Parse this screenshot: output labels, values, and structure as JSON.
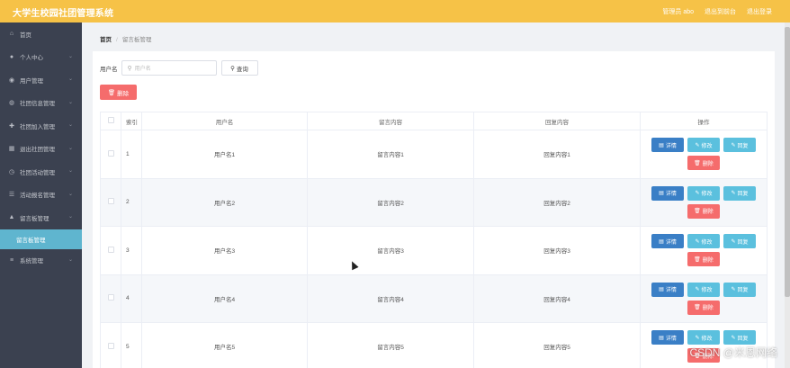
{
  "header": {
    "title": "大学生校园社团管理系统",
    "user_text": "管理员 abo",
    "link_back": "退出到前台",
    "link_logout": "退出登录"
  },
  "sidebar": {
    "items": [
      {
        "label": "首页",
        "icon": "home-icon",
        "glyph": "⌂",
        "expandable": false
      },
      {
        "label": "个人中心",
        "icon": "user-icon",
        "glyph": "●",
        "expandable": true
      },
      {
        "label": "用户管理",
        "icon": "location-icon",
        "glyph": "◉",
        "expandable": true
      },
      {
        "label": "社团信息管理",
        "icon": "info-icon",
        "glyph": "◍",
        "expandable": true
      },
      {
        "label": "社团加入管理",
        "icon": "user-add-icon",
        "glyph": "✚",
        "expandable": true
      },
      {
        "label": "退出社团管理",
        "icon": "grid-icon",
        "glyph": "▦",
        "expandable": true
      },
      {
        "label": "社团活动管理",
        "icon": "clock-icon",
        "glyph": "◷",
        "expandable": true
      },
      {
        "label": "活动报名管理",
        "icon": "list-icon",
        "glyph": "☰",
        "expandable": true
      },
      {
        "label": "留言板管理",
        "icon": "person-icon",
        "glyph": "▲",
        "expandable": true
      },
      {
        "label": "留言板管理",
        "icon": "",
        "glyph": "",
        "expandable": false,
        "sub": true,
        "active": true
      },
      {
        "label": "系统管理",
        "icon": "menu-icon",
        "glyph": "≡",
        "expandable": true
      }
    ]
  },
  "breadcrumb": {
    "home": "首页",
    "separator": "/",
    "current": "留言板管理"
  },
  "search": {
    "label": "用户名",
    "placeholder": "用户名",
    "button": "查询"
  },
  "bulk_delete": "删除",
  "table": {
    "columns": [
      "索引",
      "用户名",
      "留言内容",
      "回复内容",
      "操作"
    ],
    "rows": [
      {
        "index": "1",
        "username": "用户名1",
        "message": "留言内容1",
        "reply": "回复内容1"
      },
      {
        "index": "2",
        "username": "用户名2",
        "message": "留言内容2",
        "reply": "回复内容2"
      },
      {
        "index": "3",
        "username": "用户名3",
        "message": "留言内容3",
        "reply": "回复内容3"
      },
      {
        "index": "4",
        "username": "用户名4",
        "message": "留言内容4",
        "reply": "回复内容4"
      },
      {
        "index": "5",
        "username": "用户名5",
        "message": "留言内容5",
        "reply": "回复内容5"
      }
    ],
    "actions": {
      "detail": "详情",
      "edit": "修改",
      "reply": "回复",
      "delete": "删除"
    }
  },
  "watermark": "CSDN @米恩网络",
  "colors": {
    "header": "#f6c247",
    "sidebar": "#3b4150",
    "sidebar_active": "#5fb5cf",
    "danger": "#f56c6c",
    "primary": "#3a7fc6",
    "info": "#5bc0de"
  }
}
